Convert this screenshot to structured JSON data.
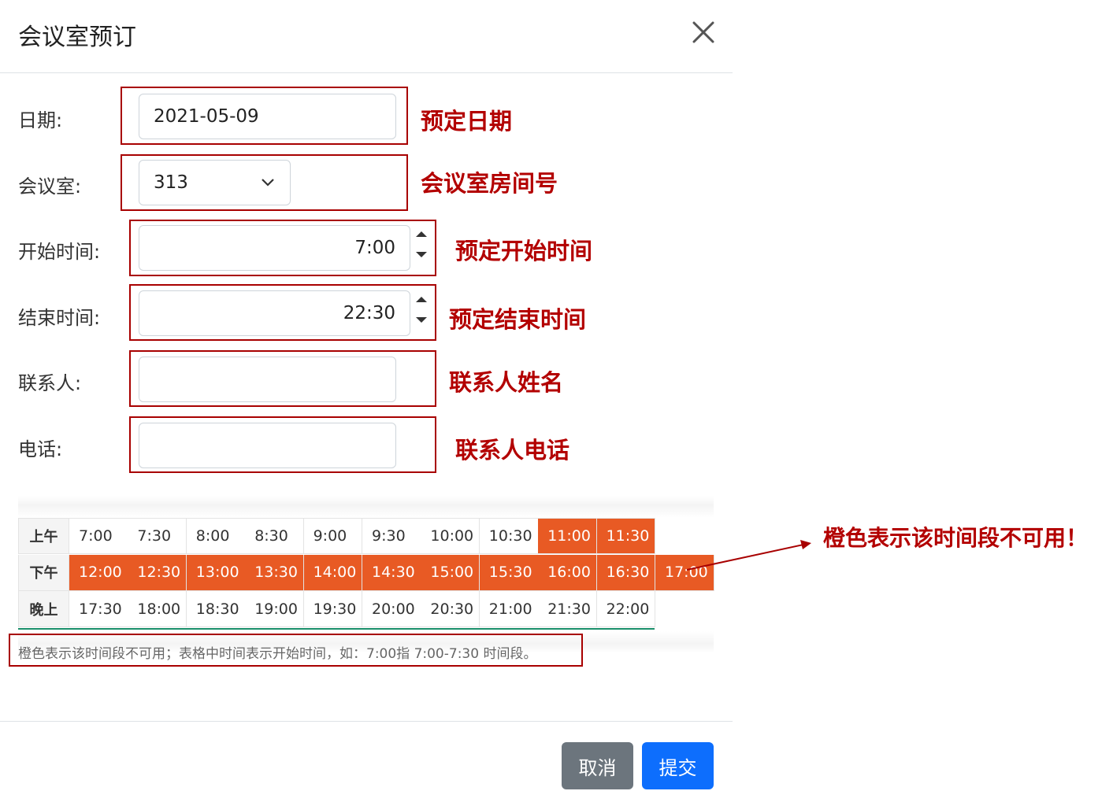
{
  "modal": {
    "title": "会议室预订",
    "close_icon": "close-icon"
  },
  "form": {
    "date": {
      "label": "日期:",
      "value": "2021-05-09"
    },
    "room": {
      "label": "会议室:",
      "value": "313",
      "icon": "chevron-down-icon"
    },
    "start": {
      "label": "开始时间:",
      "value": "7:00"
    },
    "end": {
      "label": "结束时间:",
      "value": "22:30"
    },
    "contact": {
      "label": "联系人:",
      "value": ""
    },
    "phone": {
      "label": "电话:",
      "value": ""
    }
  },
  "annotations": {
    "date": "预定日期",
    "room": "会议室房间号",
    "start": "预定开始时间",
    "end": "预定结束时间",
    "contact": "联系人姓名",
    "phone": "联系人电话",
    "orange": "橙色表示该时间段不可用！"
  },
  "schedule": {
    "busy_color": "#e85a24",
    "rows": [
      {
        "label": "上午",
        "slots": [
          {
            "t": "7:00",
            "busy": false
          },
          {
            "t": "7:30",
            "busy": false
          },
          {
            "t": "8:00",
            "busy": false
          },
          {
            "t": "8:30",
            "busy": false
          },
          {
            "t": "9:00",
            "busy": false
          },
          {
            "t": "9:30",
            "busy": false
          },
          {
            "t": "10:00",
            "busy": false
          },
          {
            "t": "10:30",
            "busy": false
          },
          {
            "t": "11:00",
            "busy": true
          },
          {
            "t": "11:30",
            "busy": true
          }
        ]
      },
      {
        "label": "下午",
        "slots": [
          {
            "t": "12:00",
            "busy": true
          },
          {
            "t": "12:30",
            "busy": true
          },
          {
            "t": "13:00",
            "busy": true
          },
          {
            "t": "13:30",
            "busy": true
          },
          {
            "t": "14:00",
            "busy": true
          },
          {
            "t": "14:30",
            "busy": true
          },
          {
            "t": "15:00",
            "busy": true
          },
          {
            "t": "15:30",
            "busy": true
          },
          {
            "t": "16:00",
            "busy": true
          },
          {
            "t": "16:30",
            "busy": true
          },
          {
            "t": "17:00",
            "busy": true
          }
        ]
      },
      {
        "label": "晚上",
        "slots": [
          {
            "t": "17:30",
            "busy": false
          },
          {
            "t": "18:00",
            "busy": false
          },
          {
            "t": "18:30",
            "busy": false
          },
          {
            "t": "19:00",
            "busy": false
          },
          {
            "t": "19:30",
            "busy": false
          },
          {
            "t": "20:00",
            "busy": false
          },
          {
            "t": "20:30",
            "busy": false
          },
          {
            "t": "21:00",
            "busy": false
          },
          {
            "t": "21:30",
            "busy": false
          },
          {
            "t": "22:00",
            "busy": false
          }
        ]
      }
    ],
    "note": "橙色表示该时间段不可用；表格中时间表示开始时间，如：7:00指 7:00-7:30 时间段。"
  },
  "footer": {
    "cancel_label": "取消",
    "submit_label": "提交"
  }
}
